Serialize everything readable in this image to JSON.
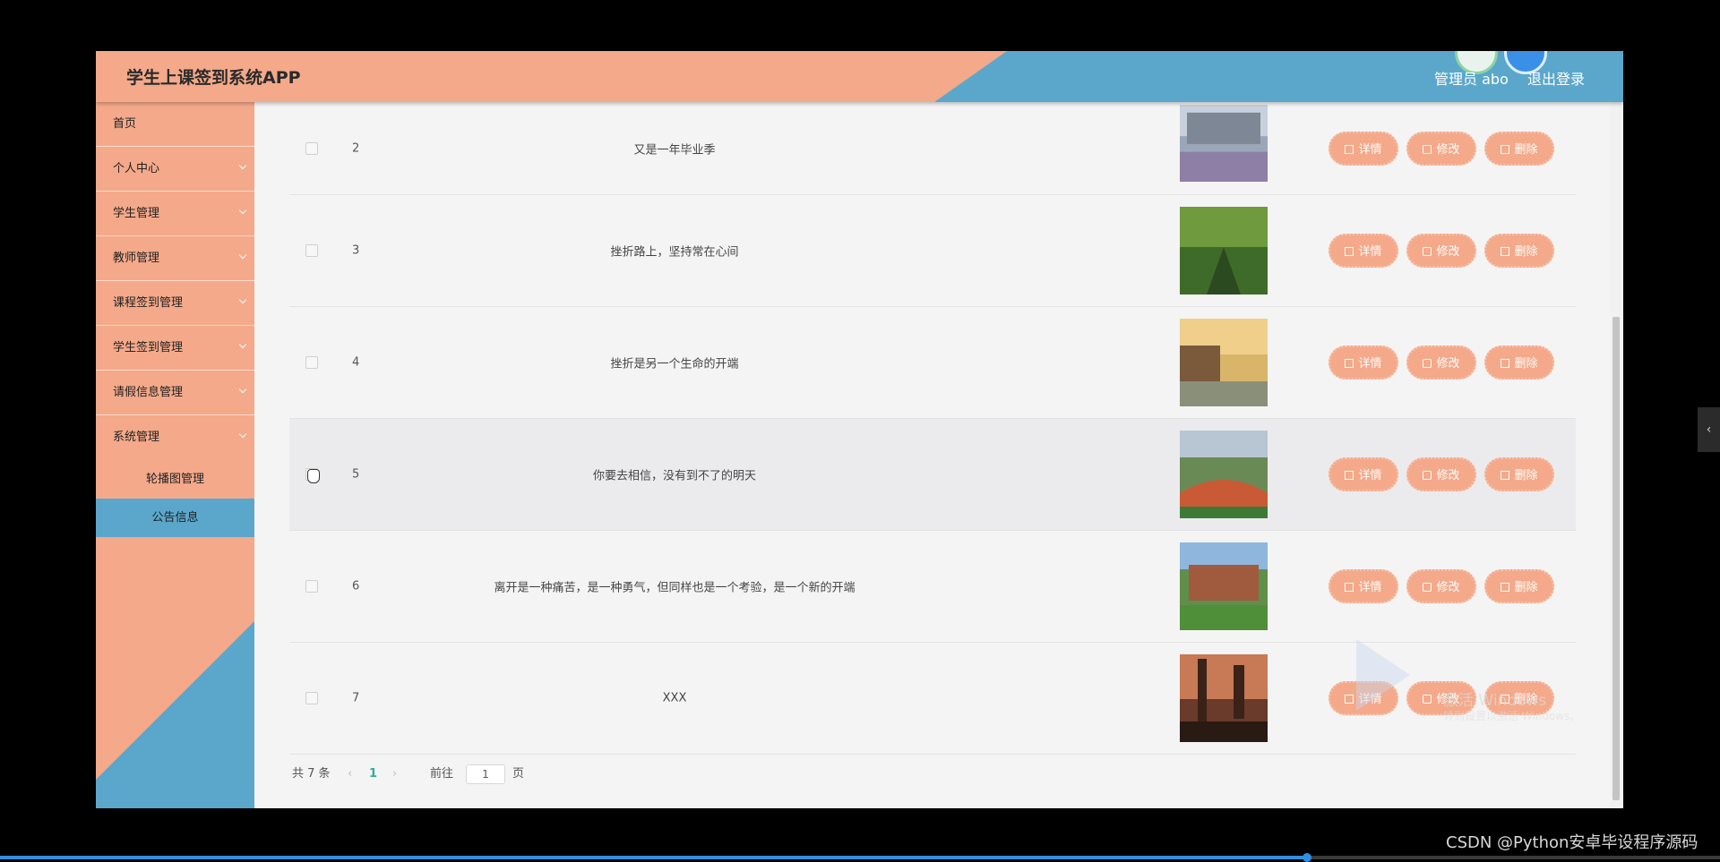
{
  "app": {
    "title": "学生上课签到系统APP",
    "user_label": "管理员 abo",
    "logout_label": "退出登录"
  },
  "sidebar": {
    "items": [
      {
        "label": "首页",
        "has_children": false
      },
      {
        "label": "个人中心",
        "has_children": true
      },
      {
        "label": "学生管理",
        "has_children": true
      },
      {
        "label": "教师管理",
        "has_children": true
      },
      {
        "label": "课程签到管理",
        "has_children": true
      },
      {
        "label": "学生签到管理",
        "has_children": true
      },
      {
        "label": "请假信息管理",
        "has_children": true
      },
      {
        "label": "系统管理",
        "has_children": true
      }
    ],
    "sub_items": [
      {
        "label": "轮播图管理",
        "active": false
      },
      {
        "label": "公告信息",
        "active": true
      }
    ]
  },
  "table": {
    "rows": [
      {
        "index": "2",
        "title": "又是一年毕业季",
        "image": "campus-building-photo"
      },
      {
        "index": "3",
        "title": "挫折路上，坚持常在心间",
        "image": "tree-lined-path-photo"
      },
      {
        "index": "4",
        "title": "挫折是另一个生命的开端",
        "image": "campus-sunset-photo"
      },
      {
        "index": "5",
        "title": "你要去相信，没有到不了的明天",
        "image": "sports-field-photo"
      },
      {
        "index": "6",
        "title": "离开是一种痛苦，是一种勇气，但同样也是一个考验，是一个新的开端",
        "image": "campus-courtyard-photo"
      },
      {
        "index": "7",
        "title": "XXX",
        "image": "gothic-building-photo"
      }
    ],
    "actions": {
      "detail": "详情",
      "edit": "修改",
      "delete": "删除"
    }
  },
  "pagination": {
    "total": "共 7 条",
    "current_page": "1",
    "goto_prefix": "前往",
    "goto_value": "1",
    "goto_suffix": "页"
  },
  "overlay": {
    "activation_title": "激活 Windows",
    "activation_sub": "转到设置以激活 Windows。",
    "credit": "CSDN @Python安卓毕设程序源码",
    "side_tab": "‹",
    "video_progress": 0.76
  },
  "colors": {
    "salmon": "#f4a98a",
    "blue": "#5ba7cb",
    "active_page": "#2ab09a"
  }
}
